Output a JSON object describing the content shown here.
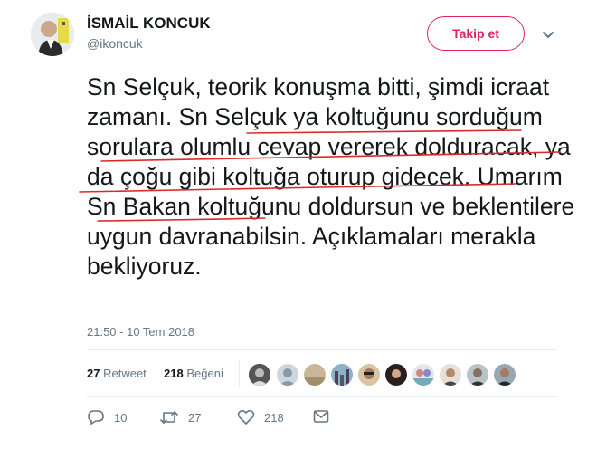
{
  "author": {
    "name": "İSMAİL KONCUK",
    "handle": "@ikoncuk"
  },
  "follow_label": "Takip et",
  "tweet_text": "Sn Selçuk, teorik konuşma bitti, şimdi icraat zamanı. Sn Selçuk ya koltuğunu sorduğum sorulara olumlu cevap vererek dolduracak, ya da çoğu gibi koltuğa oturup gidecek. Umarım Sn Bakan koltuğunu doldursun ve beklentilere uygun davranabilsin. Açıklamaları merakla bekliyoruz.",
  "timestamp": "21:50 - 10 Tem 2018",
  "stats": {
    "retweet_count": "27",
    "retweet_label": "Retweet",
    "like_count": "218",
    "like_label": "Beğeni"
  },
  "actions": {
    "reply_count": "10",
    "retweet_count": "27",
    "like_count": "218"
  },
  "colors": {
    "follow_accent": "#e0245e",
    "underline": "#d92b2b",
    "muted": "#657786"
  },
  "icons": [
    "chevron-down-icon",
    "reply-icon",
    "retweet-icon",
    "heart-icon",
    "message-icon"
  ]
}
